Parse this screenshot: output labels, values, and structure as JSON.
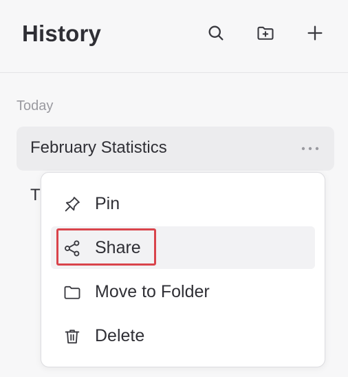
{
  "header": {
    "title": "History"
  },
  "toolbar": {
    "search_icon": "search-icon",
    "new_folder_icon": "folder-plus-icon",
    "new_chat_icon": "plus-icon"
  },
  "section": {
    "label": "Today"
  },
  "items": [
    {
      "label": "February Statistics"
    },
    {
      "label": "T"
    }
  ],
  "menu": {
    "items": [
      {
        "label": "Pin",
        "icon": "pin-icon"
      },
      {
        "label": "Share",
        "icon": "share-icon"
      },
      {
        "label": "Move to Folder",
        "icon": "folder-icon"
      },
      {
        "label": "Delete",
        "icon": "trash-icon"
      }
    ]
  },
  "colors": {
    "highlight": "#d9434b",
    "background": "#f7f7f8"
  }
}
